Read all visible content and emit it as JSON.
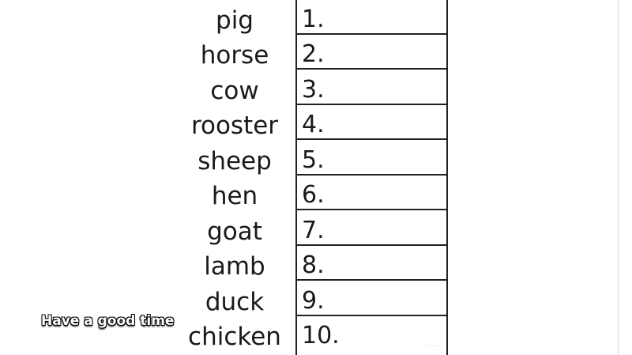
{
  "worksheet": {
    "animals": [
      "pig",
      "horse",
      "cow",
      "rooster",
      "sheep",
      "hen",
      "goat",
      "lamb",
      "duck",
      "chicken"
    ],
    "numbers": [
      "1.",
      "2.",
      "3.",
      "4.",
      "5.",
      "6.",
      "7.",
      "8.",
      "9.",
      "10."
    ]
  },
  "caption": {
    "text": "Have a good time"
  },
  "colors": {
    "text": "#1a1a1a",
    "grid_lines": "#222222",
    "caption_fill": "#ffffff",
    "caption_outline": "#000000"
  }
}
